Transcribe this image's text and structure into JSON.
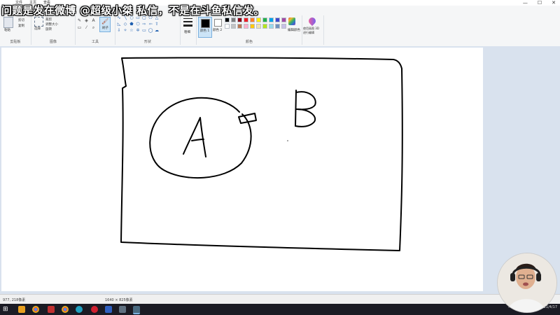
{
  "window": {
    "tabs": [
      "文件",
      "主页",
      "查看"
    ],
    "controls": [
      "—",
      "☐",
      "✕"
    ]
  },
  "overlay": {
    "message": "问题是发在微博 @超级小桀 私信，不是在斗鱼私信发。"
  },
  "ribbon": {
    "groups": [
      {
        "name": "clipboard",
        "label": "剪贴板"
      },
      {
        "name": "image",
        "label": "图像"
      },
      {
        "name": "tools",
        "label": "工具"
      },
      {
        "name": "shapes",
        "label": "形状"
      },
      {
        "name": "colors",
        "label": "颜色"
      }
    ],
    "clipboard": {
      "paste": "粘贴",
      "cut": "剪切",
      "copy": "复制"
    },
    "image": {
      "select": "选择",
      "crop": "裁剪",
      "resize": "调整大小",
      "rotate": "旋转"
    },
    "tools": {
      "brush": "刷子"
    },
    "size": {
      "label": "粗细"
    },
    "colors": {
      "color1": "颜色 1",
      "color2": "颜色 2",
      "edit": "编辑颜色",
      "paint3d": "使用画图 3D 进行编辑",
      "palette": [
        "#000000",
        "#7f7f7f",
        "#880015",
        "#ed1c24",
        "#ff7f27",
        "#fff200",
        "#22b14c",
        "#00a2e8",
        "#3f48cc",
        "#a349a4",
        "#ffffff",
        "#c3c3c3",
        "#b97a57",
        "#ffaec9",
        "#ffc90e",
        "#efe4b0",
        "#b5e61d",
        "#99d9ea",
        "#7092be",
        "#c8bfe7"
      ]
    }
  },
  "drawing": {
    "letter_a": "A",
    "letter_b": "B"
  },
  "status": {
    "cursor": "977, 218像素",
    "selection": "",
    "canvas_size": "1640 × 825像素"
  },
  "taskbar": {
    "clock_time": "",
    "clock_date": "2021/4/17"
  }
}
